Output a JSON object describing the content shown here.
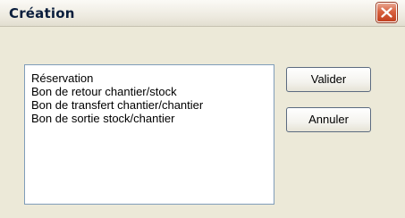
{
  "window": {
    "title": "Création",
    "close_icon": "close-icon"
  },
  "list": {
    "items": [
      "Réservation",
      "Bon de retour chantier/stock",
      "Bon de transfert chantier/chantier",
      "Bon de sortie stock/chantier"
    ]
  },
  "buttons": {
    "validate_label": "Valider",
    "cancel_label": "Annuler"
  },
  "colors": {
    "dialog_background": "#ECE9D8",
    "close_button": "#D8613F",
    "list_border": "#7F9DB9"
  }
}
